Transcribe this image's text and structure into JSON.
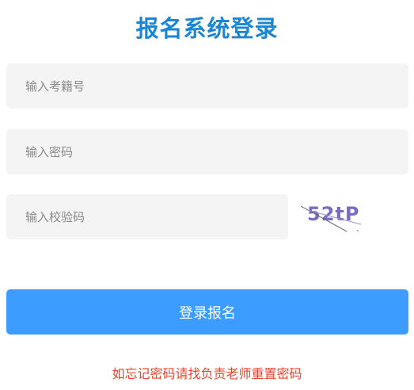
{
  "title": "报名系统登录",
  "form": {
    "exam_no_placeholder": "输入考籍号",
    "exam_no_value": "",
    "password_placeholder": "输入密码",
    "password_value": "",
    "captcha_placeholder": "输入校验码",
    "captcha_value": "",
    "captcha_image_text": "52tP"
  },
  "login_button_label": "登录报名",
  "forgot_notice": "如忘记密码请找负责老师重置密码",
  "colors": {
    "title": "#1a87d4",
    "button": "#3c9cff",
    "notice": "#e8452e",
    "input_bg": "#f4f4f4"
  }
}
